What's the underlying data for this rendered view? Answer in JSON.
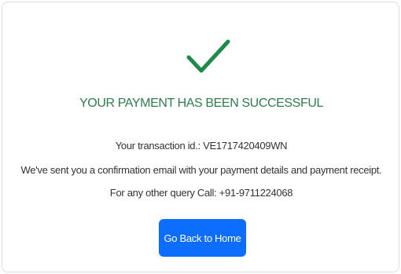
{
  "status": {
    "icon": "checkmark-icon",
    "icon_color": "#1e8a4c",
    "title": "YOUR PAYMENT HAS BEEN SUCCESSFUL",
    "title_color": "#2e7d4f"
  },
  "details": {
    "transaction_line": "Your transaction id.: VE1717420409WN",
    "email_line": "We've sent you a confirmation email with your payment details and payment receipt.",
    "query_line": "For any other query Call: +91-9711224068"
  },
  "actions": {
    "home_label": "Go Back to Home",
    "button_color": "#0d6efd"
  }
}
